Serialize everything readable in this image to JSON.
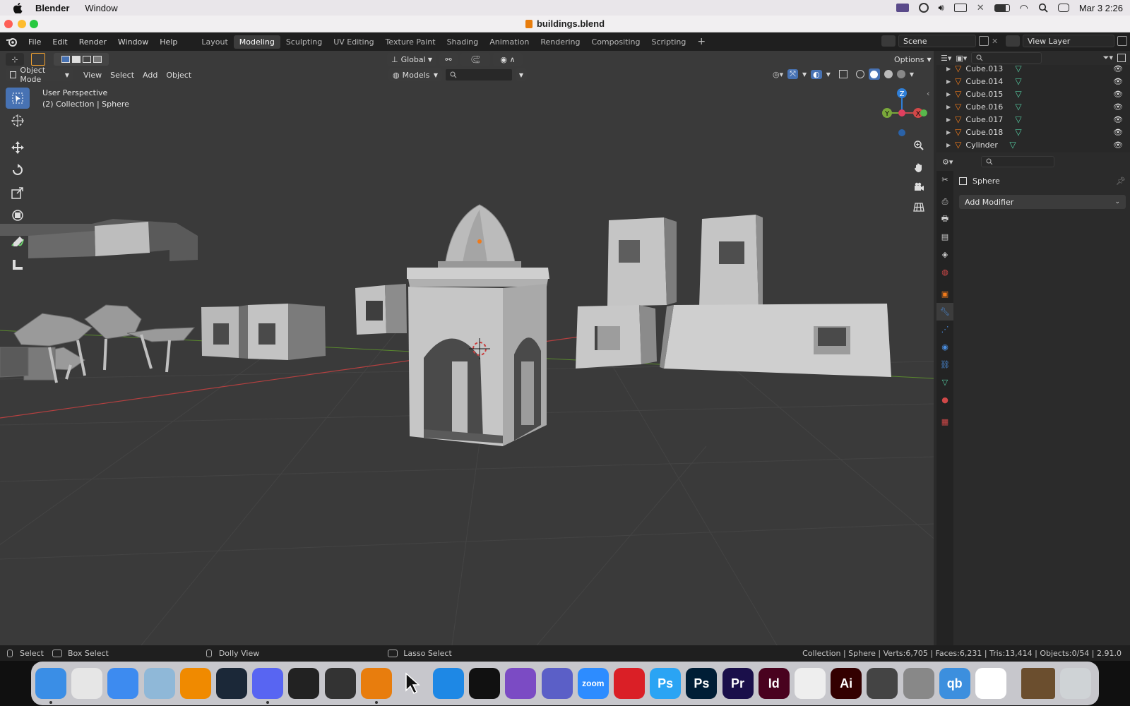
{
  "menubar": {
    "app_name": "Blender",
    "items": [
      "Window"
    ],
    "clock": "Mar 3  2:26"
  },
  "window": {
    "title": "buildings.blend"
  },
  "topbar": {
    "menus": [
      "File",
      "Edit",
      "Render",
      "Window",
      "Help"
    ],
    "workspaces": [
      "Layout",
      "Modeling",
      "Sculpting",
      "UV Editing",
      "Texture Paint",
      "Shading",
      "Animation",
      "Rendering",
      "Compositing",
      "Scripting"
    ],
    "active_workspace": "Modeling",
    "add_tab": "+",
    "scene": "Scene",
    "view_layer": "View Layer"
  },
  "viewport_header": {
    "transform_orientation": "Global",
    "options": "Options",
    "mode": "Object Mode",
    "menus": [
      "View",
      "Select",
      "Add",
      "Object"
    ],
    "collection_filter": "Models"
  },
  "viewport": {
    "view_name": "User Perspective",
    "view_context": "(2) Collection | Sphere",
    "gizmo_axes": {
      "z": "Z",
      "y": "Y",
      "x": "X"
    }
  },
  "outliner": {
    "rows": [
      {
        "name": "Cube.013"
      },
      {
        "name": "Cube.014"
      },
      {
        "name": "Cube.015"
      },
      {
        "name": "Cube.016"
      },
      {
        "name": "Cube.017"
      },
      {
        "name": "Cube.018"
      },
      {
        "name": "Cylinder"
      }
    ]
  },
  "properties": {
    "object_name": "Sphere",
    "add_modifier": "Add Modifier"
  },
  "statusbar": {
    "select": "Select",
    "box_select": "Box Select",
    "dolly_view": "Dolly View",
    "lasso_select": "Lasso Select",
    "stats": "Collection | Sphere | Verts:6,705 | Faces:6,231 | Tris:13,414 | Objects:0/54 | 2.91.0"
  },
  "dock": {
    "apps": [
      {
        "name": "Finder",
        "label": "",
        "color": "#3a8ee6"
      },
      {
        "name": "Launchpad",
        "label": "",
        "color": "#e6e6e6"
      },
      {
        "name": "Mail",
        "label": "",
        "color": "#3d8bf0"
      },
      {
        "name": "Preview",
        "label": "",
        "color": "#8fb8d8"
      },
      {
        "name": "VLC",
        "label": "",
        "color": "#f08a00"
      },
      {
        "name": "Steam",
        "label": "",
        "color": "#1b2838"
      },
      {
        "name": "Discord",
        "label": "",
        "color": "#5865f2"
      },
      {
        "name": "Sparrow",
        "label": "",
        "color": "#222"
      },
      {
        "name": "Unity",
        "label": "",
        "color": "#333"
      },
      {
        "name": "Blender",
        "label": "",
        "color": "#e87d0d"
      },
      {
        "name": "Cursor",
        "label": "",
        "color": "transparent"
      },
      {
        "name": "VS Code",
        "label": "",
        "color": "#1e88e5"
      },
      {
        "name": "Unity Hub",
        "label": "",
        "color": "#111"
      },
      {
        "name": "GitHub Desktop",
        "label": "",
        "color": "#7b4bc4"
      },
      {
        "name": "Teams",
        "label": "",
        "color": "#5b5fc7"
      },
      {
        "name": "Zoom",
        "label": "zoom",
        "color": "#2d8cff"
      },
      {
        "name": "Creative Cloud",
        "label": "",
        "color": "#da1f26"
      },
      {
        "name": "Photoshop Express",
        "label": "Ps",
        "color": "#2aa4f4"
      },
      {
        "name": "Photoshop",
        "label": "Ps",
        "color": "#001e36"
      },
      {
        "name": "Premiere Pro",
        "label": "Pr",
        "color": "#1a0f4a"
      },
      {
        "name": "InDesign",
        "label": "Id",
        "color": "#49021f"
      },
      {
        "name": "Acrobat",
        "label": "",
        "color": "#eeeeee"
      },
      {
        "name": "Illustrator",
        "label": "Ai",
        "color": "#330000"
      },
      {
        "name": "QuickTime",
        "label": "",
        "color": "#444"
      },
      {
        "name": "Font Book",
        "label": "",
        "color": "#888"
      },
      {
        "name": "qBittorrent",
        "label": "qb",
        "color": "#3c8fde"
      },
      {
        "name": "Chrome",
        "label": "",
        "color": "#ffffff"
      },
      {
        "name": "Minecraft window",
        "label": "",
        "color": "#6b4e2e"
      },
      {
        "name": "Trash",
        "label": "",
        "color": "#cfd3d6"
      }
    ]
  },
  "colors": {
    "accent": "#4772b3",
    "object_orange": "#f07a1a",
    "mesh_green": "#55c9a0",
    "axis_red": "#b54040",
    "axis_green": "#5a8a2e"
  }
}
